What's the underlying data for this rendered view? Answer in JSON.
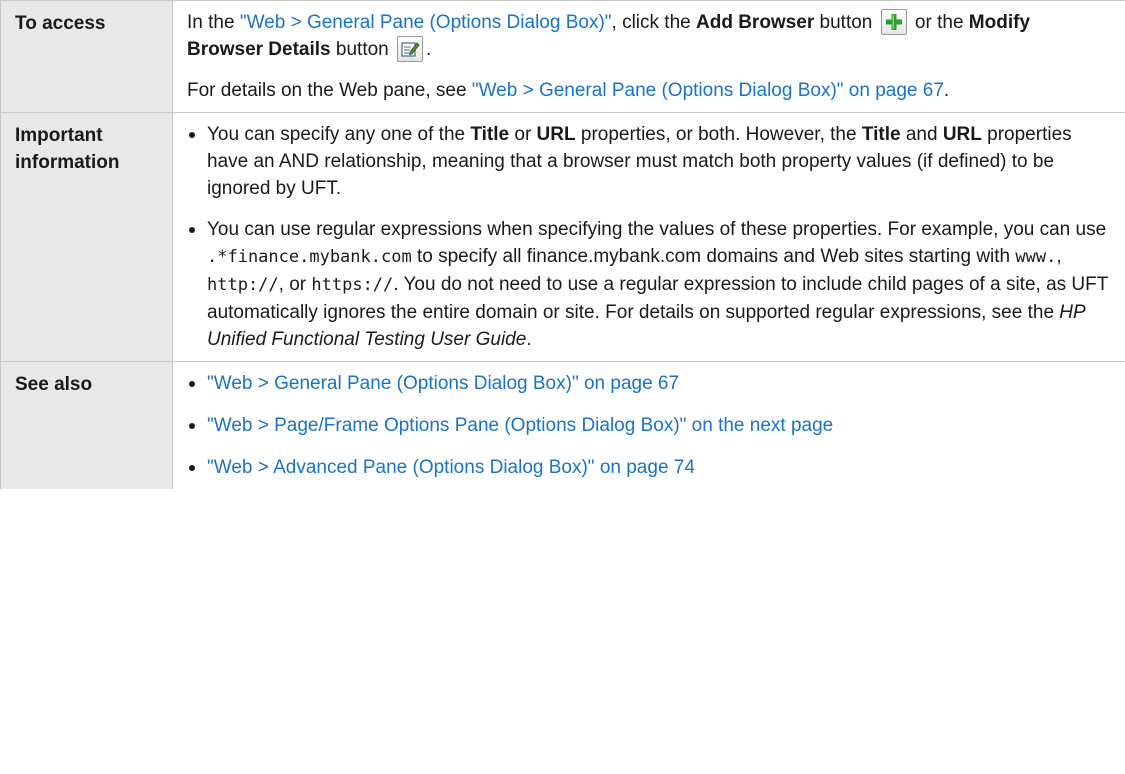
{
  "table": {
    "rows": [
      {
        "label": "To access",
        "p1": {
          "t1": "In the ",
          "link1": "\"Web > General Pane (Options Dialog Box)\"",
          "t2": ", click the ",
          "b1": "Add Browser",
          "t3": " button ",
          "t4": " or the ",
          "b2": "Modify Browser Details",
          "t5": " button ",
          "t6": "."
        },
        "p2": {
          "t1": "For details on the Web pane, see ",
          "link1": "\"Web > General Pane (Options Dialog Box)\" on page 67",
          "t2": "."
        }
      },
      {
        "label": "Important information",
        "b1": {
          "t1": "You can specify any one of the ",
          "b1": "Title",
          "t2": " or ",
          "b2": "URL",
          "t3": " properties, or both. However, the ",
          "b3": "Title",
          "t4": " and ",
          "b4": "URL",
          "t5": " properties have an AND relationship, meaning that a browser must match both property values (if defined) to be ignored by UFT."
        },
        "b2": {
          "t1": "You can use regular expressions when specifying the values of these properties. For example, you can use ",
          "c1": ".*finance.mybank.com",
          "t2": " to specify all finance.mybank.com domains and Web sites starting with ",
          "c2": "www.",
          "t3": ", ",
          "c3": "http://",
          "t4": ", or ",
          "c4": "https://",
          "t5": ". You do not need to use a regular expression to include child pages of a site, as UFT automatically ignores the entire domain or site. For details on supported regular expressions, see the ",
          "i1": "HP Unified Functional Testing User Guide",
          "t6": "."
        }
      },
      {
        "label": "See also",
        "links": [
          "\"Web > General Pane (Options Dialog Box)\" on page 67",
          "\"Web > Page/Frame Options Pane (Options Dialog Box)\" on the next page",
          "\"Web > Advanced Pane (Options Dialog Box)\" on page 74"
        ]
      }
    ]
  },
  "icons": {
    "add_browser": "plus-icon",
    "modify_browser": "edit-details-icon"
  },
  "colors": {
    "link": "#1a73c6",
    "label_background": "#e8e8e8",
    "border": "#c7c7c7",
    "plus_icon": "#2e9e2e"
  }
}
